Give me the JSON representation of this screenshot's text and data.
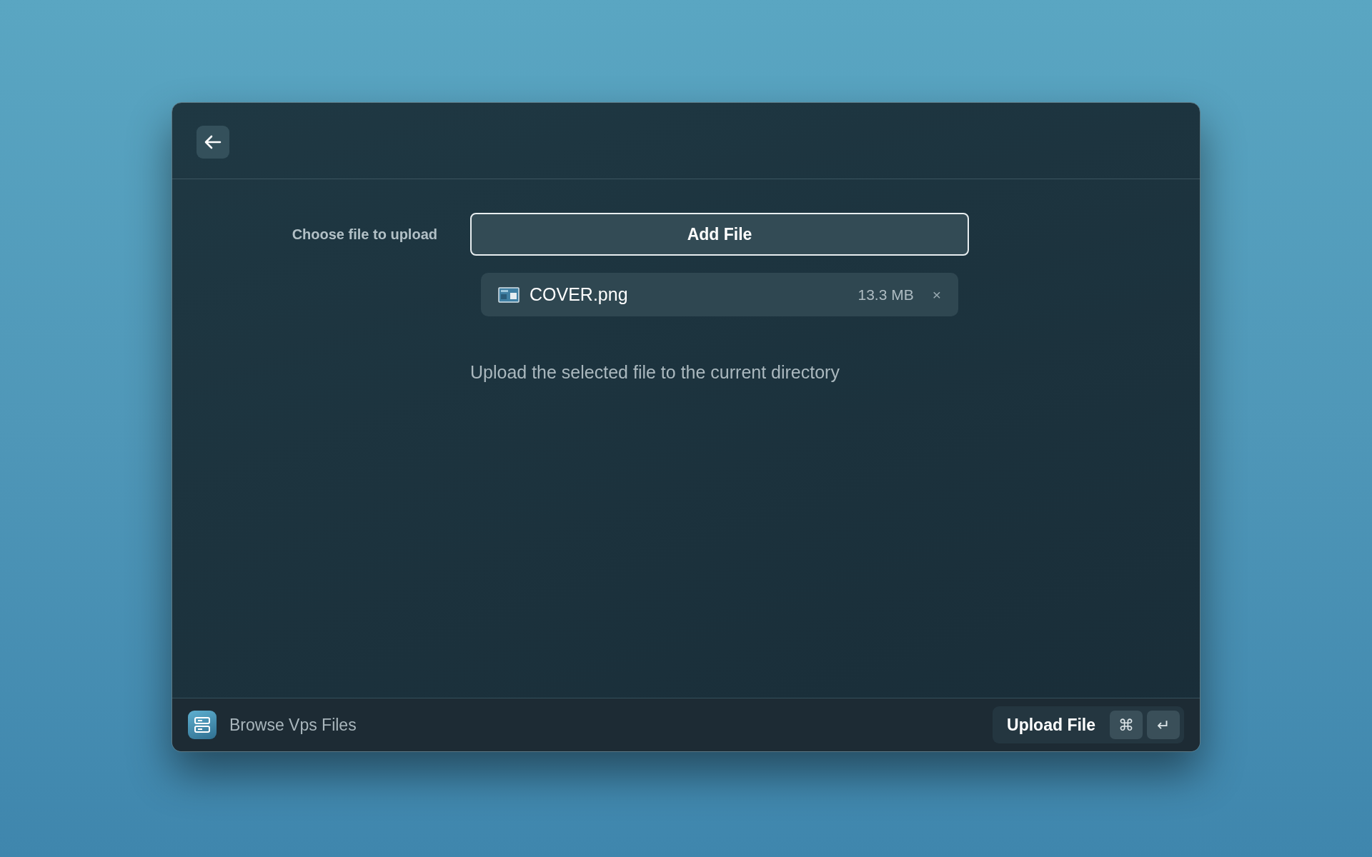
{
  "form": {
    "label": "Choose file to upload",
    "add_button": "Add File",
    "files": [
      {
        "name": "COVER.png",
        "size": "13.3 MB",
        "remove": "×"
      }
    ],
    "description": "Upload the selected file to the current directory"
  },
  "footer": {
    "title": "Browse Vps Files",
    "action": "Upload File",
    "keys": [
      "⌘",
      "↵"
    ]
  }
}
